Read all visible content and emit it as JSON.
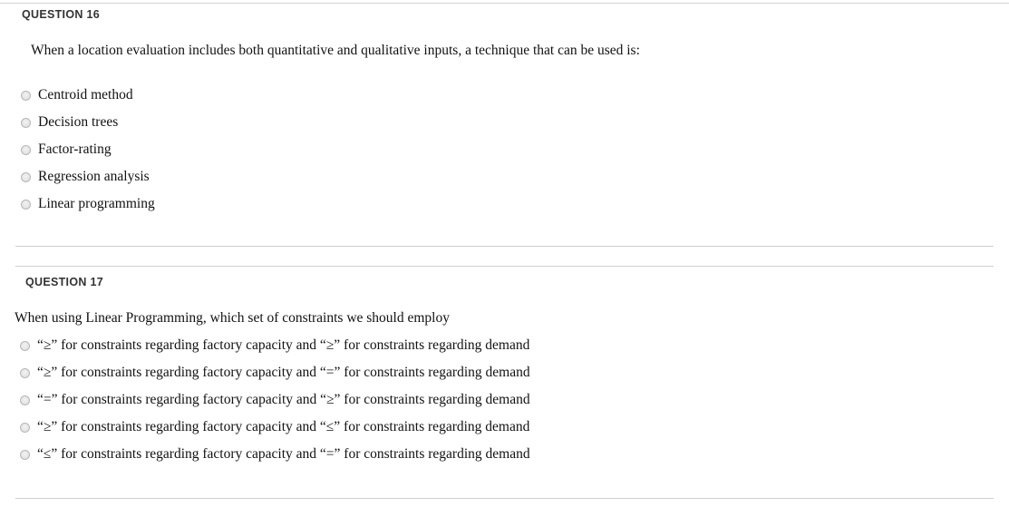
{
  "document": {
    "type": "quiz-questions",
    "background_color": "#ffffff",
    "rule_color": "#d4d4d4",
    "header_color": "#333333",
    "text_color": "#111111"
  },
  "questions": [
    {
      "header": "QUESTION 16",
      "text": "When a location evaluation includes both quantitative and qualitative inputs, a technique that can be used is:",
      "options": [
        {
          "label": "Centroid method",
          "selected": false
        },
        {
          "label": "Decision trees",
          "selected": false
        },
        {
          "label": "Factor-rating",
          "selected": false
        },
        {
          "label": "Regression analysis",
          "selected": false
        },
        {
          "label": "Linear programming",
          "selected": false
        }
      ]
    },
    {
      "header": "QUESTION 17",
      "text": "When using Linear Programming, which set of constraints we should employ",
      "options": [
        {
          "label": "“≥” for constraints regarding factory capacity and “≥” for constraints regarding demand",
          "selected": false
        },
        {
          "label": "“≥” for constraints regarding factory capacity and “=” for constraints regarding demand",
          "selected": false
        },
        {
          "label": "“=” for constraints regarding factory capacity and “≥” for constraints regarding demand",
          "selected": false
        },
        {
          "label": "“≥” for constraints regarding factory capacity and “≤” for constraints regarding demand",
          "selected": false
        },
        {
          "label": "“≤” for constraints regarding factory capacity and “=” for constraints regarding demand",
          "selected": false
        }
      ]
    }
  ]
}
